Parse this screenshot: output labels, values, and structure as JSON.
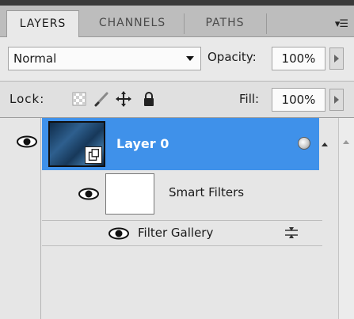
{
  "tabs": [
    {
      "label": "LAYERS",
      "active": true
    },
    {
      "label": "CHANNELS",
      "active": false
    },
    {
      "label": "PATHS",
      "active": false
    }
  ],
  "panel_menu_icon": "panel-menu-icon",
  "blend": {
    "mode": "Normal"
  },
  "opacity": {
    "label": "Opacity:",
    "value": "100%"
  },
  "lock": {
    "label": "Lock:",
    "icons": [
      "lock-transparent-pixels-icon",
      "lock-image-pixels-icon",
      "lock-position-icon",
      "lock-all-icon"
    ]
  },
  "fill": {
    "label": "Fill:",
    "value": "100%"
  },
  "layers": [
    {
      "name": "Layer 0",
      "visible": true,
      "selected": true,
      "smart_object": true
    }
  ],
  "smart_filters": {
    "label": "Smart Filters",
    "visible": true
  },
  "filters": [
    {
      "name": "Filter Gallery",
      "visible": true
    }
  ],
  "colors": {
    "selection": "#3f91ea",
    "panel": "#e9e9e9",
    "tab_bar": "#bdbdbd"
  }
}
